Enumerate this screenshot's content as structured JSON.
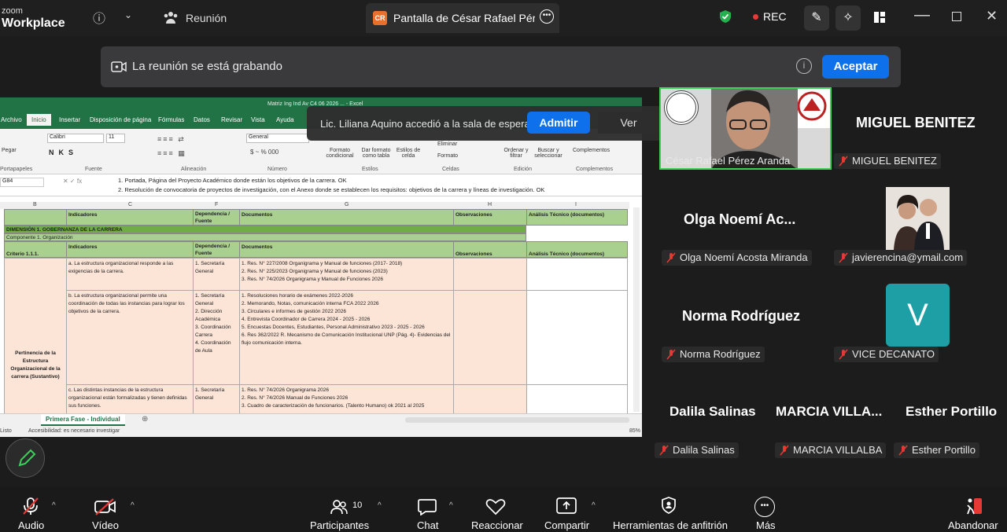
{
  "app": {
    "brand_top": "zoom",
    "brand_bottom": "Workplace"
  },
  "topbar": {
    "meeting_tab": "Reunión",
    "share_badge": "CR",
    "share_title": "Pantalla de César Rafael Pérez Ara",
    "rec_label": "REC"
  },
  "banner": {
    "text": "La reunión se está grabando",
    "accept_label": "Aceptar"
  },
  "waiting_toast": {
    "text": "Lic. Liliana Aquino accedió a la sala de espera",
    "admit_label": "Admitir",
    "view_label": "Ver"
  },
  "excel": {
    "title": "Matriz Ing Ind Av C4 06 2026 ... - Excel",
    "menu": [
      "Archivo",
      "Inicio",
      "Insertar",
      "Disposición de página",
      "Fórmulas",
      "Datos",
      "Revisar",
      "Vista",
      "Ayuda"
    ],
    "ribbon_groups": [
      "Portapapeles",
      "Fuente",
      "Alineación",
      "Número",
      "Estilos",
      "Celdas",
      "Edición",
      "Complementos"
    ],
    "font_name": "Calibri",
    "font_size": "11",
    "number_format": "General",
    "ribbon_buttons": [
      "Pegar",
      "Formato condicional",
      "Dar formato como tabla",
      "Estilos de celda",
      "Eliminar",
      "Formato",
      "Ordenar y filtrar",
      "Buscar y seleccionar",
      "Complementos"
    ],
    "name_box": "G84",
    "formula_line1": "1. Portada, Página del Proyecto Académico donde están los objetivos de la carrera. OK",
    "formula_line2": "2. Resolución de convocatoria de proyectos de investigación, con el Anexo donde se establecen los requisitos: objetivos de la carrera y líneas de investigación. OK",
    "columns": [
      "B",
      "C",
      "F",
      "G",
      "H",
      "I"
    ],
    "header_row": {
      "indicadores": "Indicadores",
      "dependencia": "Dependencia / Fuente",
      "documentos": "Documentos",
      "observaciones": "Observaciones",
      "analisis": "Análisis Técnico (documentos)"
    },
    "dimension": "DIMENSIÓN 1. GOBERNANZA DE LA CARRERA",
    "componente": "Componente 1. Organización",
    "criterio": "Criterio 1.1.1.",
    "pertinencia": "Pertinencia de la Estructura Organizacional de la carrera (Sustantivo)",
    "rows": [
      {
        "indicator": "a. La estructura organizacional responde a las exigencias de la carrera.",
        "dependencia": "1. Secretaría General",
        "docs": "1. Res. N° 227/2008 Organigrama y Manual de funciones (2017- 2018)\n2. Res. N°  225/2023 Organigrama y Manual de funciones (2023)\n3. Res. N° 74/2026 Organigrama y Manual de Funciones 2026"
      },
      {
        "indicator": "b. La estructura organizacional permite una coordinación de todas las instancias para lograr los objetivos de la carrera.",
        "dependencia": "1. Secretaría General\n2. Dirección Académica\n3. Coordinación Carrera\n4. Coordinación de Aula",
        "docs": "1. Resoluciones horario de exámenes 2022-2026\n2. Memorando, Notas, comunicación interna FCA 2022 2026\n3. Circulares e informes de gestión 2022 2026\n4. Entrevista Coordinador de Carrera 2024 - 2025 - 2026\n5. Encuestas Docentes, Estudiantes, Personal Administrativo 2023 - 2025 - 2026\n6. Res 362/2022 R. Mecanismo de Comunicación Institucional UNP (Pág. 4)- Evidencias del flujo comunicación interna."
      },
      {
        "indicator": "c. Las distintas instancias de la estructura organizacional están formalizadas y tienen definidas sus funciones.",
        "dependencia": "1. Secretaría General",
        "docs": "1. Res. N° 74/2026 Organigrama 2026\n2. Res. N° 74/2026 Manual de Funciones 2026\n3. Cuadro de caracterización de funcionarios. (Talento Humano) ok 2021 al 2025"
      }
    ],
    "sheet_tab": "Primera Fase - Individual",
    "status_ready": "Listo",
    "status_accessibility": "Accesibilidad: es necesario investigar",
    "zoom": "85%"
  },
  "participants": [
    {
      "big": "",
      "tag": "César Rafael Pérez Aranda"
    },
    {
      "big": "MIGUEL BENITEZ",
      "tag": "MIGUEL BENITEZ"
    },
    {
      "big": "Olga  Noemí  Ac...",
      "tag": "Olga Noemí Acosta Miranda"
    },
    {
      "big": "",
      "tag": "javierencina@ymail.com"
    },
    {
      "big": "Norma Rodríguez",
      "tag": "Norma Rodríguez"
    },
    {
      "big": "V",
      "tag": "VICE DECANATO"
    },
    {
      "big": "Dalila Salinas",
      "tag": "Dalila Salinas"
    },
    {
      "big": "MARCIA  VILLA...",
      "tag": "MARCIA VILLALBA"
    },
    {
      "big": "Esther Portillo",
      "tag": "Esther Portillo"
    }
  ],
  "toolbar": {
    "audio": "Audio",
    "video": "Vídeo",
    "participants": "Participantes",
    "participants_count": "10",
    "chat": "Chat",
    "react": "Reaccionar",
    "share": "Compartir",
    "host_tools": "Herramientas de anfitrión",
    "more": "Más",
    "leave": "Abandonar"
  },
  "colors": {
    "accent": "#0e71eb",
    "excel_green": "#217346",
    "header_green": "#a9d08e",
    "row_peach": "#fce4d6",
    "speaker_border": "#3ecf5b",
    "rec_red": "#e53935"
  }
}
